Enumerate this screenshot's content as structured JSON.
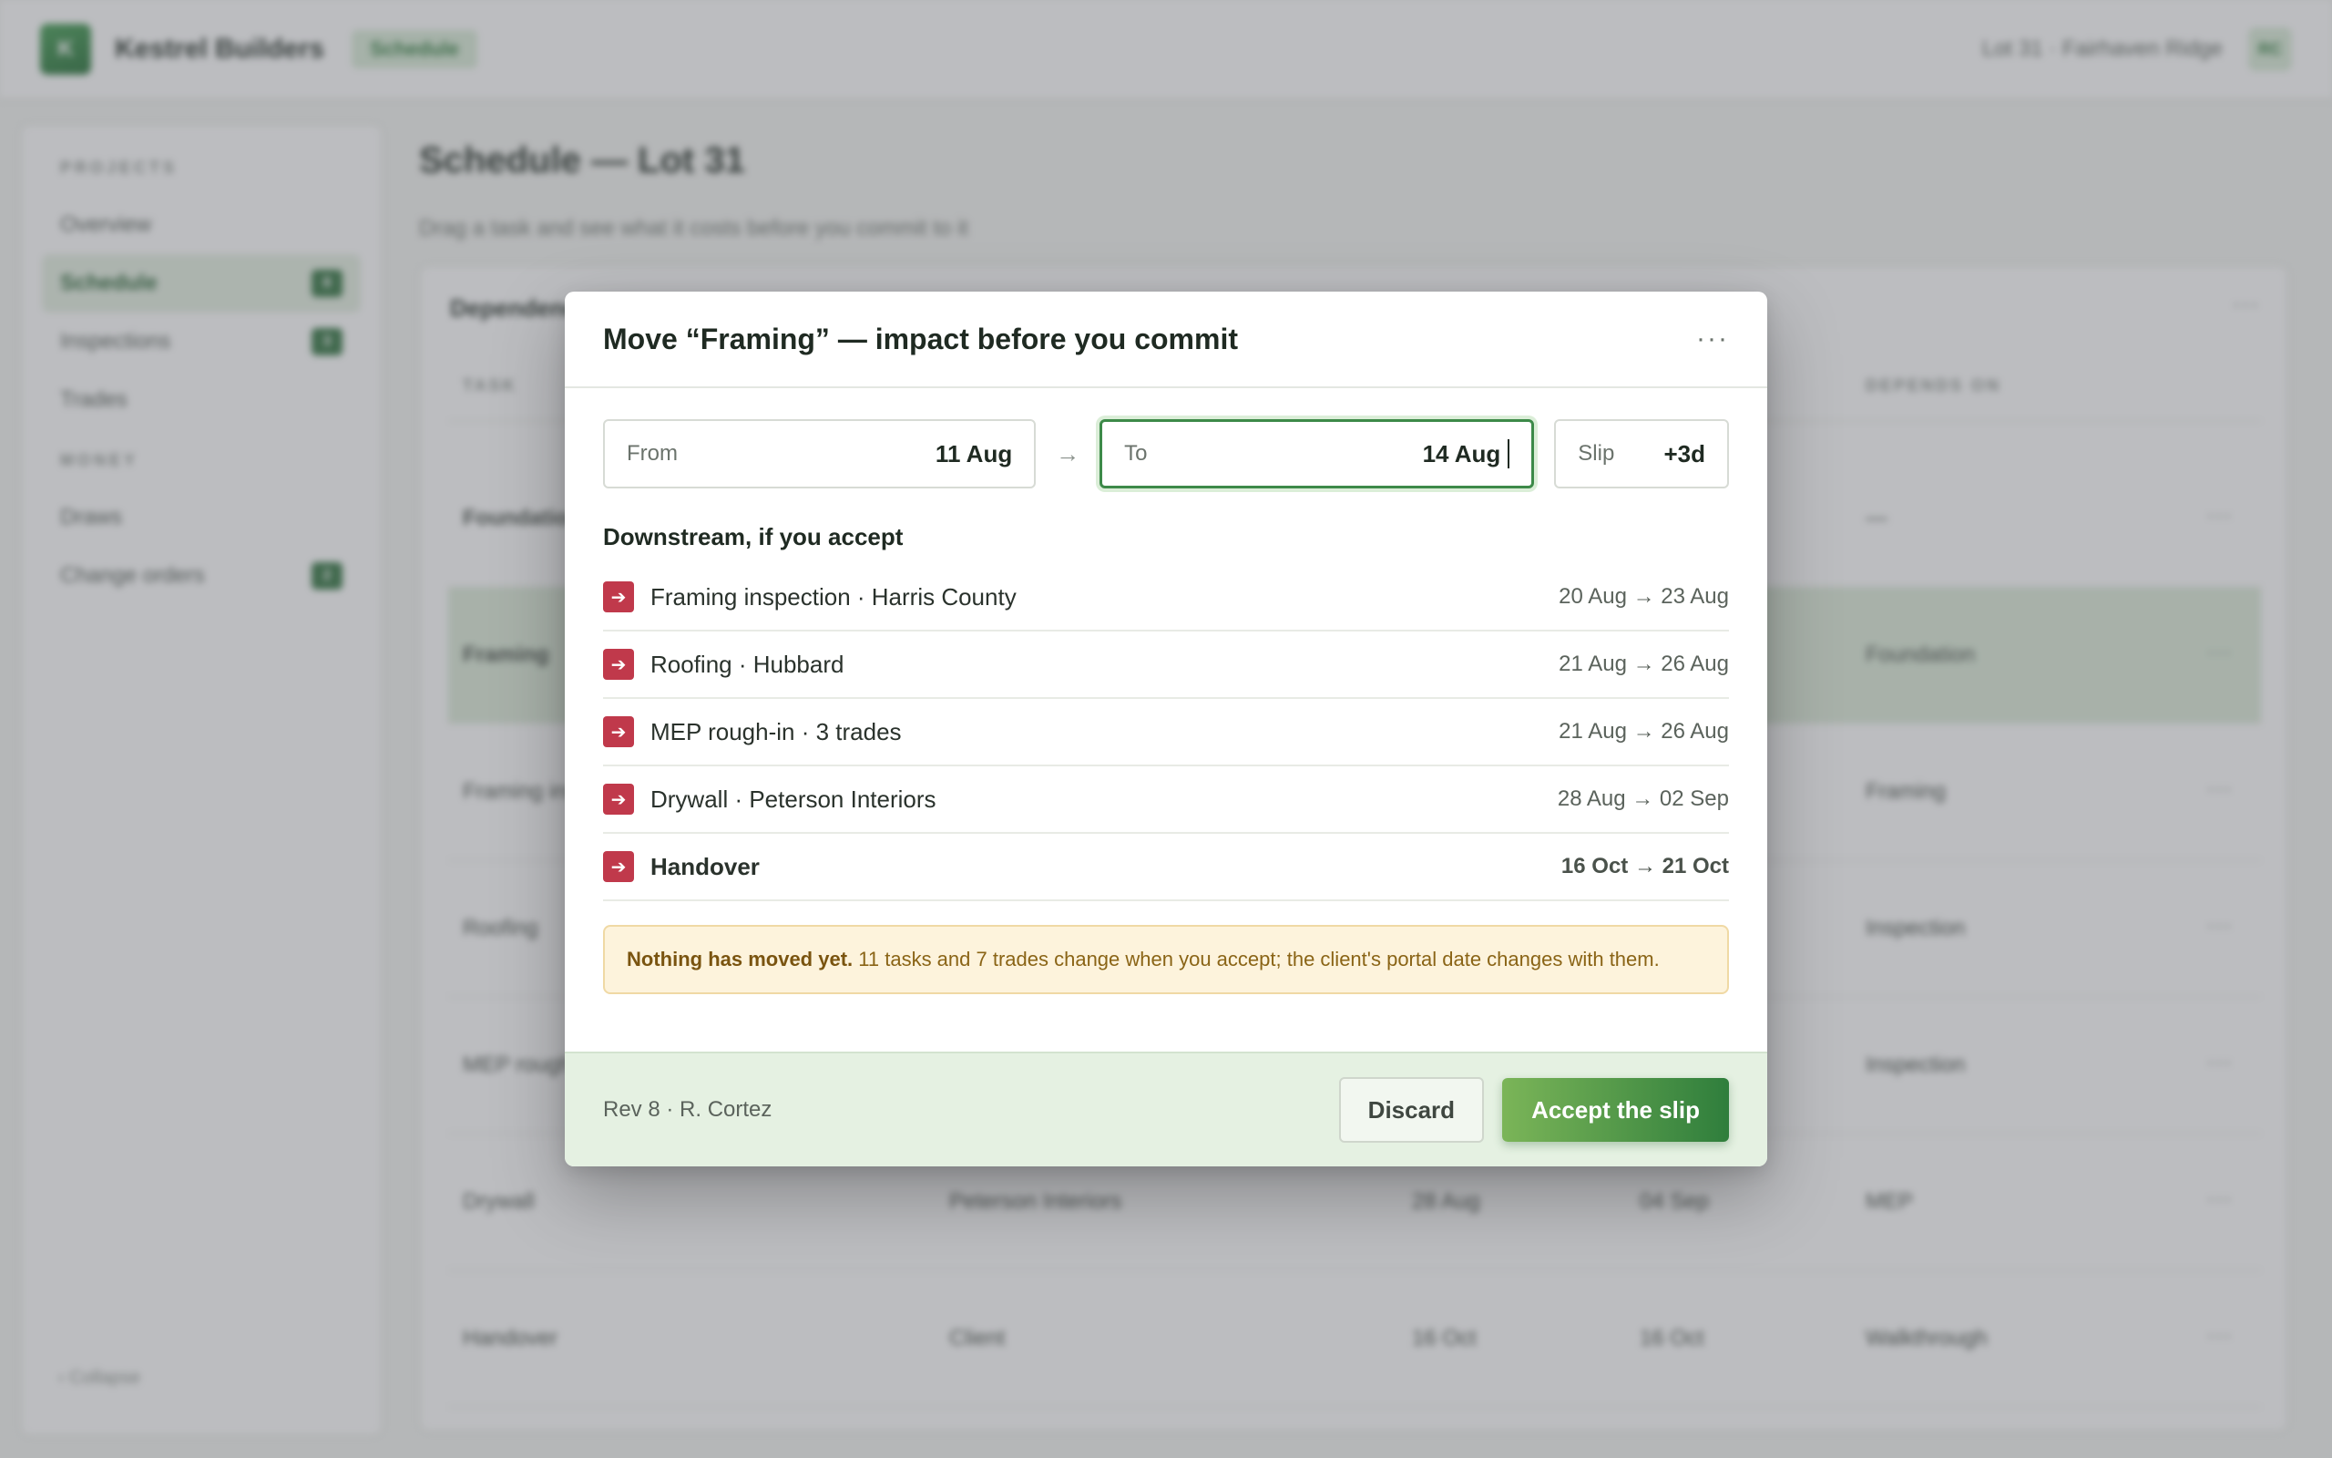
{
  "topbar": {
    "logo_letter": "K",
    "brand": "Kestrel Builders",
    "section_pill": "Schedule",
    "project": "Lot 31 · Fairhaven Ridge",
    "avatar_initials": "RC"
  },
  "sidebar": {
    "projects_heading": "PROJECTS",
    "money_heading": "MONEY",
    "items": [
      {
        "label": "Overview",
        "badge": ""
      },
      {
        "label": "Schedule",
        "badge": "8"
      },
      {
        "label": "Inspections",
        "badge": "3"
      },
      {
        "label": "Trades",
        "badge": ""
      },
      {
        "label": "Draws",
        "badge": ""
      },
      {
        "label": "Change orders",
        "badge": "2"
      }
    ],
    "collapse": "‹ Collapse"
  },
  "main": {
    "title": "Schedule — Lot 31",
    "subtitle": "Drag a task and see what it costs before you commit to it"
  },
  "card": {
    "title": "Dependencies",
    "menu": "···",
    "headers": {
      "task": "TASK",
      "depends_on": "DEPENDS ON"
    },
    "rows": [
      {
        "task": "Foundation",
        "trade": "",
        "start": "",
        "end": "",
        "depends": "—"
      },
      {
        "task": "Framing",
        "trade": "",
        "start": "",
        "end": "",
        "depends": "Foundation"
      },
      {
        "task": "Framing inspection",
        "trade": "",
        "start": "",
        "end": "",
        "depends": "Framing"
      },
      {
        "task": "Roofing",
        "trade": "",
        "start": "",
        "end": "",
        "depends": "Inspection"
      },
      {
        "task": "MEP rough-in",
        "trade": "",
        "start": "",
        "end": "",
        "depends": "Inspection"
      },
      {
        "task": "Drywall",
        "trade": "Peterson Interiors",
        "start": "28 Aug",
        "end": "04 Sep",
        "depends": "MEP"
      },
      {
        "task": "Handover",
        "trade": "Client",
        "start": "16 Oct",
        "end": "16 Oct",
        "depends": "Walkthrough"
      }
    ],
    "row_menu": "···"
  },
  "modal": {
    "title": "Move “Framing” — impact before you commit",
    "menu": "···",
    "from_label": "From",
    "from_value": "11 Aug",
    "arrow": "→",
    "to_label": "To",
    "to_value": "14 Aug",
    "slip_label": "Slip",
    "slip_value": "+3d",
    "downstream_title": "Downstream, if you accept",
    "downstream": [
      {
        "icon": "arrow-right-icon",
        "glyph": "➔",
        "name": "Framing inspection · Harris County",
        "dates": "20 Aug → 23 Aug"
      },
      {
        "icon": "arrow-right-icon",
        "glyph": "➔",
        "name": "Roofing · Hubbard",
        "dates": "21 Aug → 26 Aug"
      },
      {
        "icon": "arrow-right-icon",
        "glyph": "➔",
        "name": "MEP rough-in · 3 trades",
        "dates": "21 Aug → 26 Aug"
      },
      {
        "icon": "arrow-right-icon",
        "glyph": "➔",
        "name": "Drywall · Peterson Interiors",
        "dates": "28 Aug → 02 Sep"
      },
      {
        "icon": "arrow-right-icon",
        "glyph": "➔",
        "name": "Handover",
        "dates": "16 Oct → 21 Oct"
      }
    ],
    "notice_strong": "Nothing has moved yet.",
    "notice_text": " 11 tasks and 7 trades change when you accept; the client's portal date changes with them.",
    "revision": "Rev 8 · R. Cortez",
    "discard_label": "Discard",
    "accept_label": "Accept the slip"
  },
  "colors": {
    "accent": "#2f7e3c",
    "impact": "#c0394b",
    "notice_bg": "#fdf3dc"
  }
}
